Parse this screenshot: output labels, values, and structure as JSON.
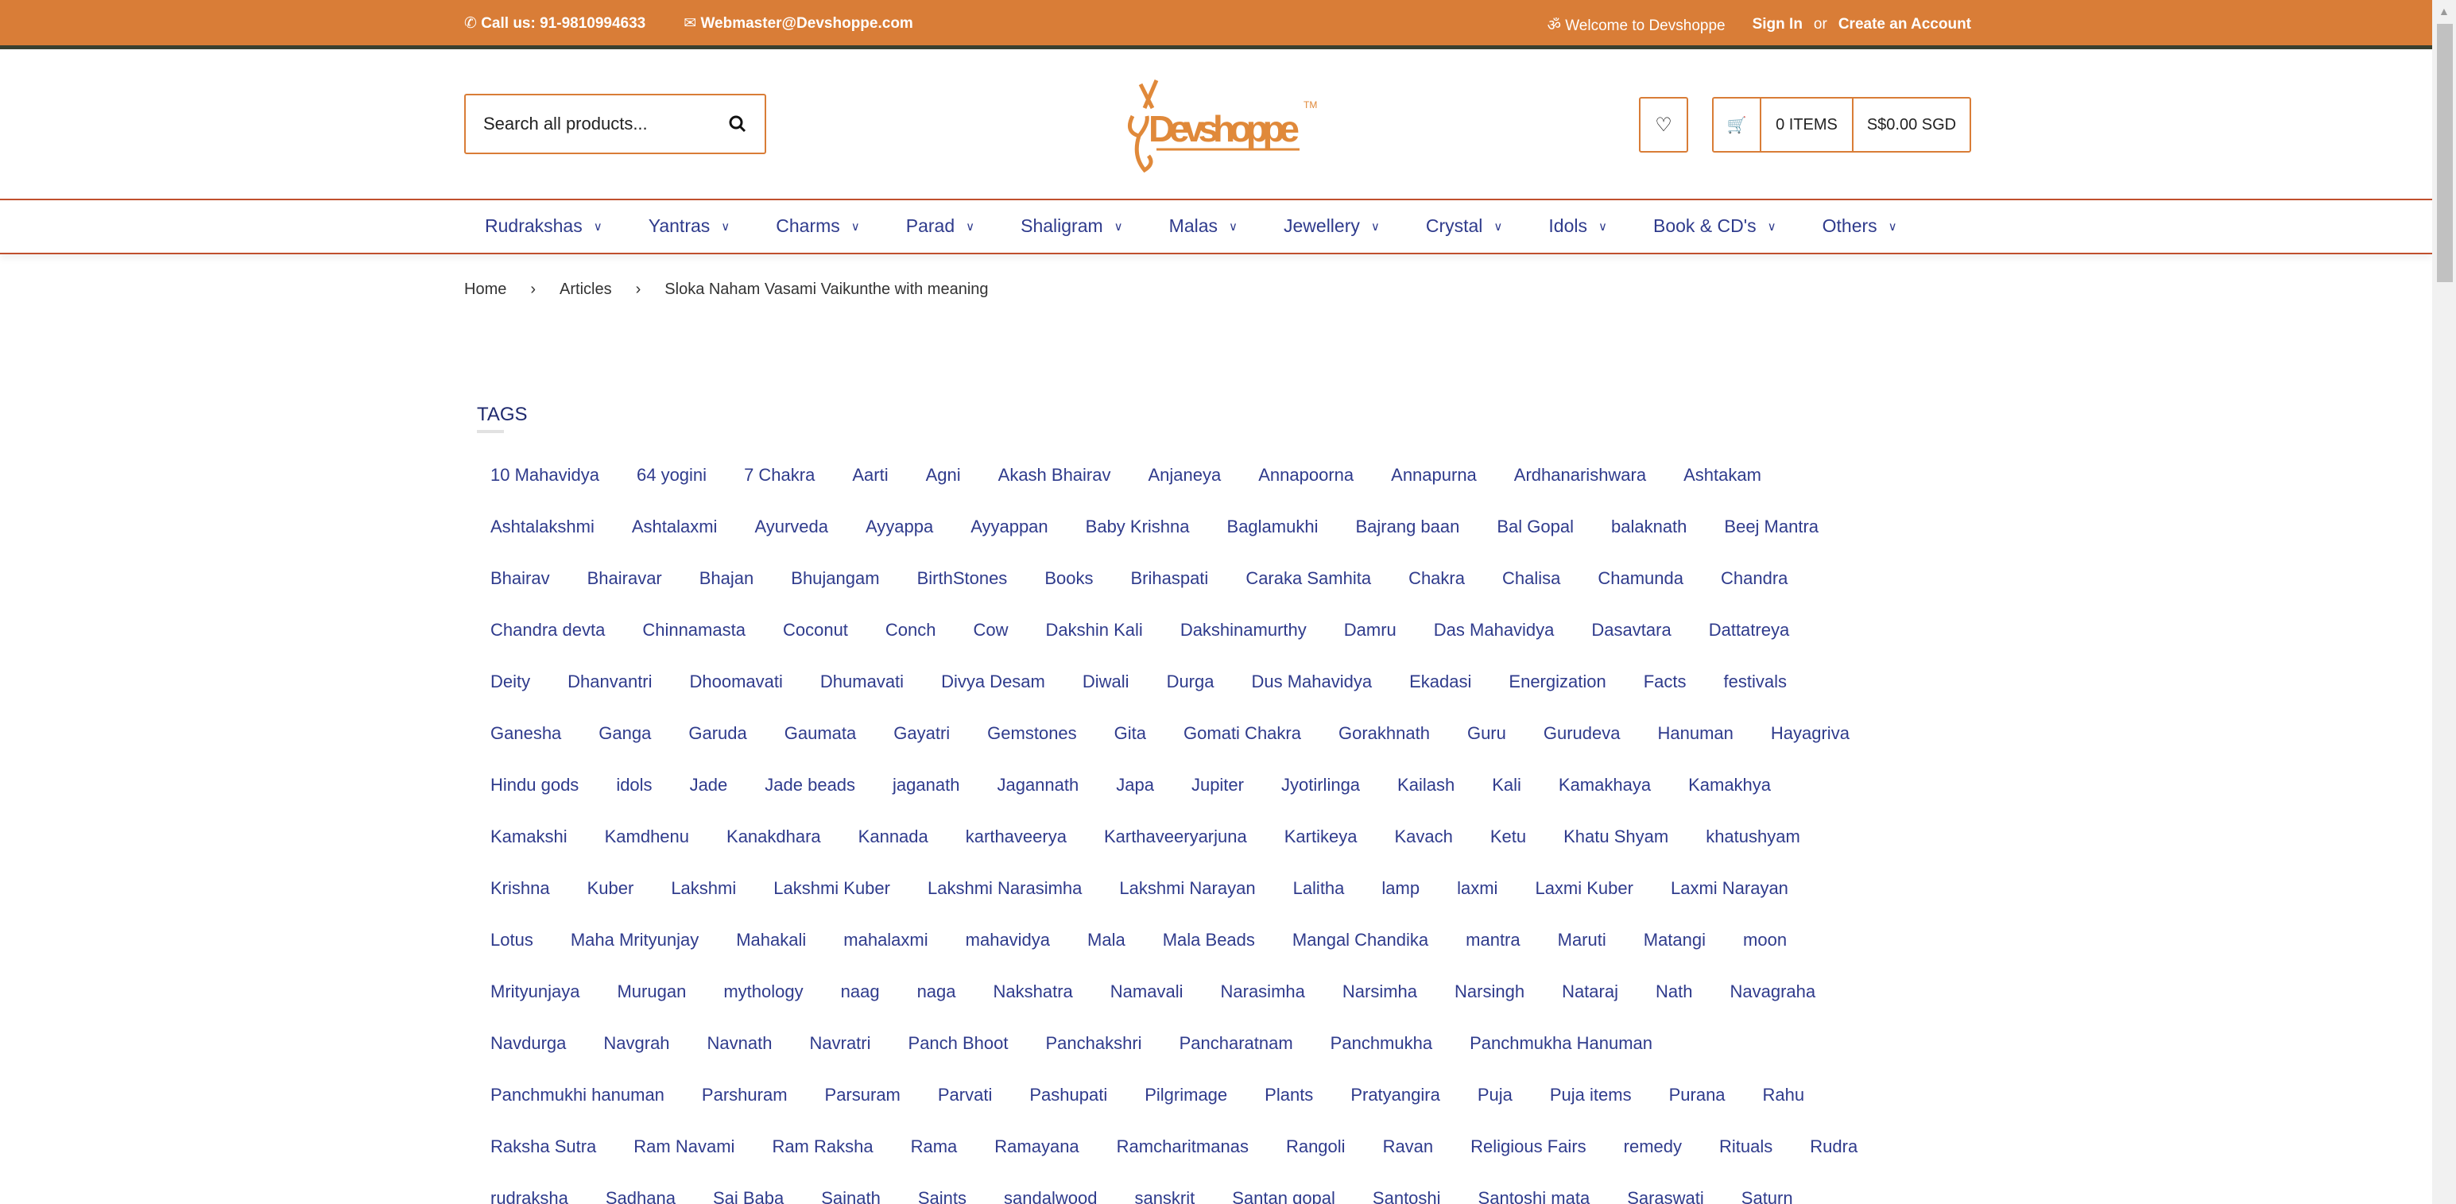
{
  "topbar": {
    "phone": "Call us: 91-9810994633",
    "email": "Webmaster@Devshoppe.com",
    "welcome": "Welcome to Devshoppe",
    "signin": "Sign In",
    "or": "or",
    "create": "Create an Account"
  },
  "header": {
    "search_placeholder": "Search all products...",
    "logo_text": "Devshoppe",
    "cart_items": "0 ITEMS",
    "cart_total": "S$0.00 SGD"
  },
  "nav": [
    "Rudrakshas",
    "Yantras",
    "Charms",
    "Parad",
    "Shaligram",
    "Malas",
    "Jewellery",
    "Crystal",
    "Idols",
    "Book & CD's",
    "Others"
  ],
  "breadcrumb": [
    "Home",
    "Articles",
    "Sloka Naham Vasami Vaikunthe with meaning"
  ],
  "tags_title": "TAGS",
  "tag_rows": [
    [
      "10 Mahavidya",
      "64 yogini",
      "7 Chakra",
      "Aarti",
      "Agni",
      "Akash Bhairav",
      "Anjaneya",
      "Annapoorna",
      "Annapurna",
      "Ardhanarishwara",
      "Ashtakam"
    ],
    [
      "Ashtalakshmi",
      "Ashtalaxmi",
      "Ayurveda",
      "Ayyappa",
      "Ayyappan",
      "Baby Krishna",
      "Baglamukhi",
      "Bajrang baan",
      "Bal Gopal",
      "balaknath",
      "Beej Mantra"
    ],
    [
      "Bhairav",
      "Bhairavar",
      "Bhajan",
      "Bhujangam",
      "BirthStones",
      "Books",
      "Brihaspati",
      "Caraka Samhita",
      "Chakra",
      "Chalisa",
      "Chamunda",
      "Chandra"
    ],
    [
      "Chandra devta",
      "Chinnamasta",
      "Coconut",
      "Conch",
      "Cow",
      "Dakshin Kali",
      "Dakshinamurthy",
      "Damru",
      "Das Mahavidya",
      "Dasavtara",
      "Dattatreya"
    ],
    [
      "Deity",
      "Dhanvantri",
      "Dhoomavati",
      "Dhumavati",
      "Divya Desam",
      "Diwali",
      "Durga",
      "Dus Mahavidya",
      "Ekadasi",
      "Energization",
      "Facts",
      "festivals"
    ],
    [
      "Ganesha",
      "Ganga",
      "Garuda",
      "Gaumata",
      "Gayatri",
      "Gemstones",
      "Gita",
      "Gomati Chakra",
      "Gorakhnath",
      "Guru",
      "Gurudeva",
      "Hanuman",
      "Hayagriva"
    ],
    [
      "Hindu gods",
      "idols",
      "Jade",
      "Jade beads",
      "jaganath",
      "Jagannath",
      "Japa",
      "Jupiter",
      "Jyotirlinga",
      "Kailash",
      "Kali",
      "Kamakhaya",
      "Kamakhya"
    ],
    [
      "Kamakshi",
      "Kamdhenu",
      "Kanakdhara",
      "Kannada",
      "karthaveerya",
      "Karthaveeryarjuna",
      "Kartikeya",
      "Kavach",
      "Ketu",
      "Khatu Shyam",
      "khatushyam"
    ],
    [
      "Krishna",
      "Kuber",
      "Lakshmi",
      "Lakshmi Kuber",
      "Lakshmi Narasimha",
      "Lakshmi Narayan",
      "Lalitha",
      "lamp",
      "laxmi",
      "Laxmi Kuber",
      "Laxmi Narayan"
    ],
    [
      "Lotus",
      "Maha Mrityunjay",
      "Mahakali",
      "mahalaxmi",
      "mahavidya",
      "Mala",
      "Mala Beads",
      "Mangal Chandika",
      "mantra",
      "Maruti",
      "Matangi",
      "moon"
    ],
    [
      "Mrityunjaya",
      "Murugan",
      "mythology",
      "naag",
      "naga",
      "Nakshatra",
      "Namavali",
      "Narasimha",
      "Narsimha",
      "Narsingh",
      "Nataraj",
      "Nath",
      "Navagraha"
    ],
    [
      "Navdurga",
      "Navgrah",
      "Navnath",
      "Navratri",
      "Panch Bhoot",
      "Panchakshri",
      "Pancharatnam",
      "Panchmukha",
      "Panchmukha Hanuman"
    ],
    [
      "Panchmukhi hanuman",
      "Parshuram",
      "Parsuram",
      "Parvati",
      "Pashupati",
      "Pilgrimage",
      "Plants",
      "Pratyangira",
      "Puja",
      "Puja items",
      "Purana",
      "Rahu"
    ],
    [
      "Raksha Sutra",
      "Ram Navami",
      "Ram Raksha",
      "Rama",
      "Ramayana",
      "Ramcharitmanas",
      "Rangoli",
      "Ravan",
      "Religious Fairs",
      "remedy",
      "Rituals",
      "Rudra"
    ],
    [
      "rudraksha",
      "Sadhana",
      "Sai Baba",
      "Sainath",
      "Saints",
      "sandalwood",
      "sanskrit",
      "Santan gopal",
      "Santoshi",
      "Santoshi mata",
      "Saraswati",
      "Saturn"
    ]
  ],
  "colors": {
    "brand": "#d97d37",
    "link": "#2f3b8c"
  }
}
